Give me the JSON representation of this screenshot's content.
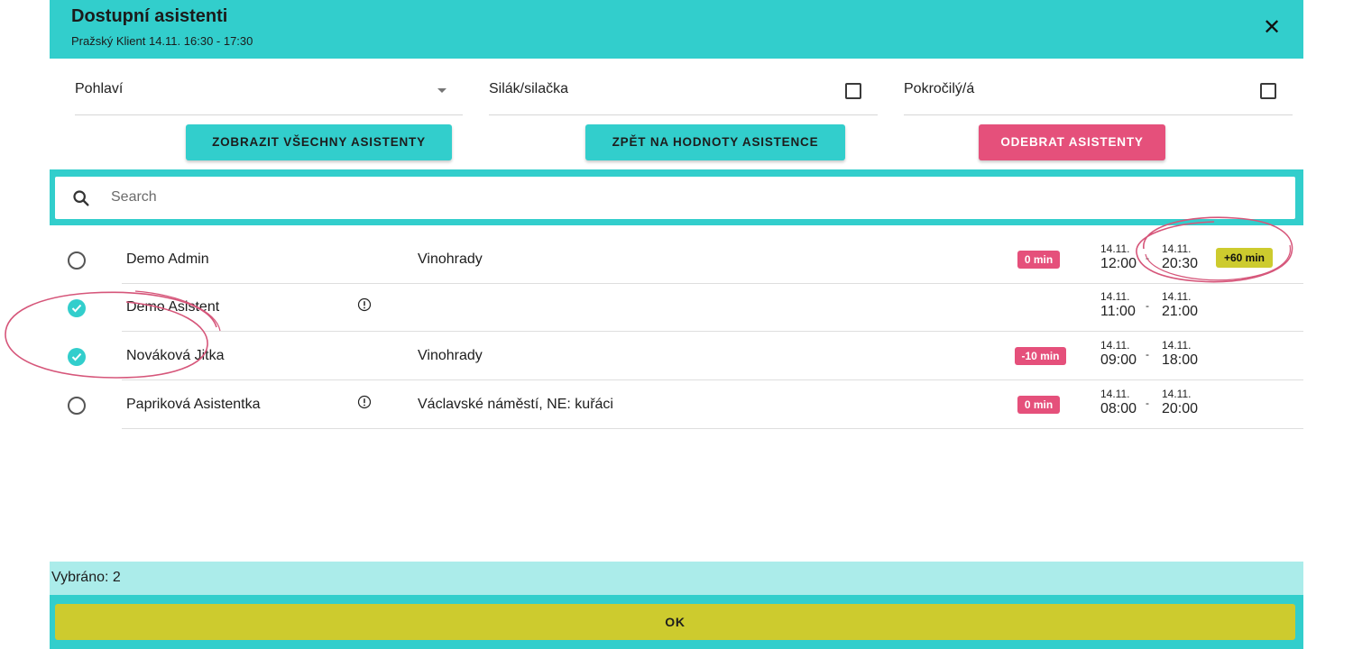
{
  "header": {
    "title": "Dostupní asistenti",
    "subtitle": "Pražský Klient 14.11. 16:30 - 17:30",
    "close_icon": "✕"
  },
  "filters": {
    "gender_label": "Pohlaví",
    "strong_label": "Silák/silačka",
    "advanced_label": "Pokročilý/á"
  },
  "buttons": {
    "show_all": "ZOBRAZIT VŠECHNY ASISTENTY",
    "back_to_values": "ZPĚT NA HODNOTY ASISTENCE",
    "remove": "ODEBRAT ASISTENTY"
  },
  "search": {
    "placeholder": "Search",
    "value": ""
  },
  "rows": [
    {
      "name": "Demo Admin",
      "selected": false,
      "info": false,
      "location": "Vinohrady",
      "badge": "0 min",
      "from_date": "14.11.",
      "from_time": "12:00",
      "to_date": "14.11.",
      "to_time": "20:30",
      "extra": "+60 min"
    },
    {
      "name": "Demo Asistent",
      "selected": true,
      "info": true,
      "location": "",
      "badge": "",
      "from_date": "14.11.",
      "from_time": "11:00",
      "to_date": "14.11.",
      "to_time": "21:00",
      "extra": ""
    },
    {
      "name": "Nováková Jitka",
      "selected": true,
      "info": false,
      "location": "Vinohrady",
      "badge": "-10 min",
      "from_date": "14.11.",
      "from_time": "09:00",
      "to_date": "14.11.",
      "to_time": "18:00",
      "extra": ""
    },
    {
      "name": "Papriková Asistentka",
      "selected": false,
      "info": true,
      "location": "Václavské náměstí, NE: kuřáci",
      "badge": "0 min",
      "from_date": "14.11.",
      "from_time": "08:00",
      "to_date": "14.11.",
      "to_time": "20:00",
      "extra": ""
    }
  ],
  "footer": {
    "selected_text": "Vybráno: 2",
    "ok_label": "OK"
  },
  "colors": {
    "teal": "#32CECC",
    "light_teal": "#ABECEA",
    "pink": "#E5507B",
    "olive": "#CDCB2E"
  }
}
